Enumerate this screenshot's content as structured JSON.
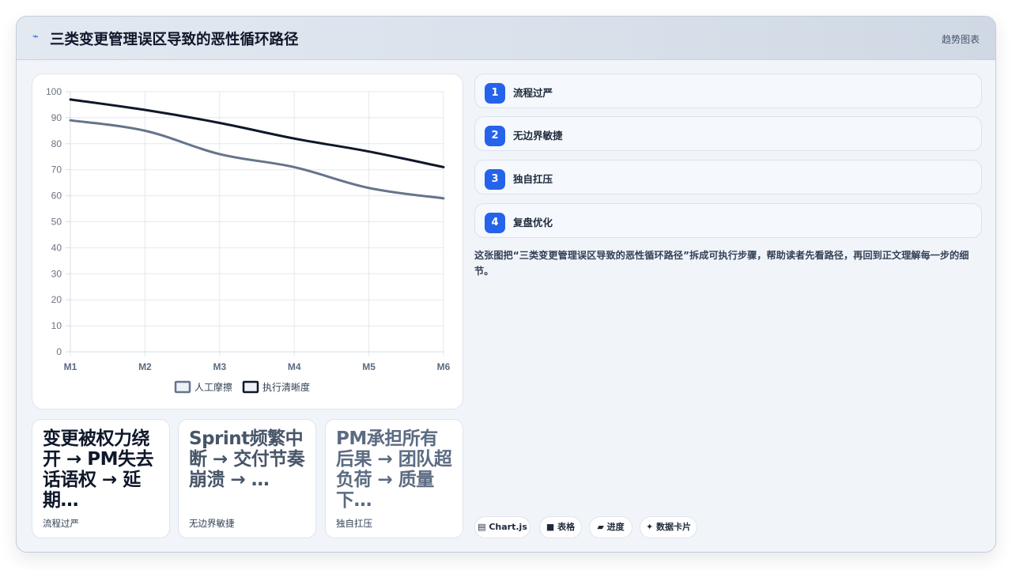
{
  "header": {
    "icon": "lightning-icon",
    "title": "三类变更管理误区导致的恶性循环路径",
    "tag": "趋势图表"
  },
  "chart_data": {
    "type": "line",
    "categories": [
      "M1",
      "M2",
      "M3",
      "M4",
      "M5",
      "M6"
    ],
    "series": [
      {
        "name": "人工摩擦",
        "values": [
          89,
          85,
          76,
          71,
          63,
          59
        ],
        "color": "#64748b"
      },
      {
        "name": "执行清晰度",
        "values": [
          97,
          93,
          88,
          82,
          77,
          71
        ],
        "color": "#0f172a"
      }
    ],
    "ylim": [
      0,
      100
    ],
    "yticks": [
      0,
      10,
      20,
      30,
      40,
      50,
      60,
      70,
      80,
      90,
      100
    ],
    "grid": true,
    "legend": "bottom",
    "title": "",
    "xlabel": "",
    "ylabel": ""
  },
  "cards": [
    {
      "big": "变更被权力绕开 → PM失去话语权 → 延期…",
      "caption": "流程过严"
    },
    {
      "big": "Sprint频繁中断 → 交付节奏崩溃 → …",
      "caption": "无边界敏捷"
    },
    {
      "big": "PM承担所有后果 → 团队超负荷 → 质量下…",
      "caption": "独自扛压"
    }
  ],
  "steps": [
    {
      "num": "1",
      "label": "流程过严"
    },
    {
      "num": "2",
      "label": "无边界敏捷"
    },
    {
      "num": "3",
      "label": "独自扛压"
    },
    {
      "num": "4",
      "label": "复盘优化"
    }
  ],
  "description": "这张图把“三类变更管理误区导致的恶性循环路径”拆成可执行步骤，帮助读者先看路径，再回到正文理解每一步的细节。",
  "chips": [
    {
      "icon": "chart-icon",
      "glyph": "▤",
      "label": "Chart.js"
    },
    {
      "icon": "table-icon",
      "glyph": "■",
      "label": "表格"
    },
    {
      "icon": "progress-icon",
      "glyph": "▰",
      "label": "进度"
    },
    {
      "icon": "sparkle-icon",
      "glyph": "✦",
      "label": "数据卡片"
    }
  ]
}
